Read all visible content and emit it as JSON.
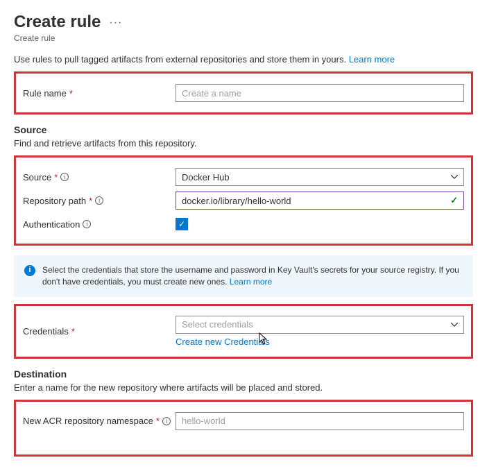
{
  "header": {
    "title": "Create rule",
    "subtitle": "Create rule",
    "intro": "Use rules to pull tagged artifacts from external repositories and store them in yours.",
    "learnMore": "Learn more"
  },
  "ruleName": {
    "label": "Rule name",
    "placeholder": "Create a name"
  },
  "source": {
    "heading": "Source",
    "description": "Find and retrieve artifacts from this repository.",
    "sourceLabel": "Source",
    "sourceValue": "Docker Hub",
    "repoPathLabel": "Repository path",
    "repoPathValue": "docker.io/library/hello-world",
    "authLabel": "Authentication"
  },
  "banner": {
    "text": "Select the credentials that store the username and password in Key Vault's secrets for your source registry. If you don't have credentials, you must create new ones.",
    "learnMore": "Learn more"
  },
  "credentials": {
    "label": "Credentials",
    "placeholder": "Select credentials",
    "createLink": "Create new Credentials"
  },
  "destination": {
    "heading": "Destination",
    "description": "Enter a name for the new repository where artifacts will be placed and stored.",
    "namespaceLabel": "New ACR repository namespace",
    "namespaceValue": "hello-world"
  }
}
